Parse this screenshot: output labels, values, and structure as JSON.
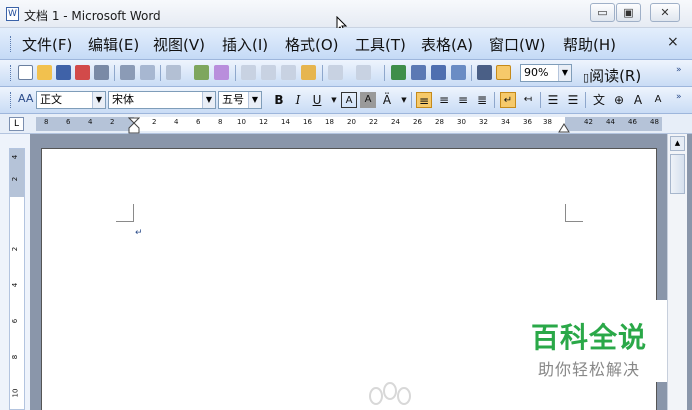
{
  "window": {
    "title": "文档 1 - Microsoft Word",
    "icon": "word-document-icon"
  },
  "window_controls": {
    "minimize": "▭",
    "maximize": "▣",
    "close": "✕"
  },
  "menu": {
    "items": [
      "文件(F)",
      "编辑(E)",
      "视图(V)",
      "插入(I)",
      "格式(O)",
      "工具(T)",
      "表格(A)",
      "窗口(W)",
      "帮助(H)"
    ],
    "close": "×"
  },
  "standard_toolbar": {
    "zoom": "90%",
    "read_label": "阅读(R)"
  },
  "formatting_toolbar": {
    "style": "正文",
    "font": "宋体",
    "size": "五号",
    "style_icon": "AA",
    "bold": "B",
    "italic": "I",
    "underline": "U",
    "char_border": "A",
    "char_shading": "A",
    "superscript_a": "A",
    "subscript_a": "A"
  },
  "ruler": {
    "left_ticks": [
      "8",
      "6",
      "4",
      "2"
    ],
    "right_ticks": [
      "2",
      "4",
      "6",
      "8",
      "10",
      "12",
      "14",
      "16",
      "18",
      "20",
      "22",
      "24",
      "26",
      "28",
      "30",
      "32",
      "34",
      "36",
      "38",
      "42",
      "44",
      "46",
      "48"
    ],
    "corner_label": "L"
  },
  "vertical_ruler": {
    "ticks": [
      "4",
      "2",
      "2",
      "4",
      "6",
      "8",
      "10"
    ]
  },
  "document": {
    "paragraph_mark": "↵"
  },
  "watermark": {
    "title": "百科全说",
    "subtitle": "助你轻松解决"
  },
  "colors": {
    "watermark_green": "#2aa848",
    "toolbar_blue": "#c9dcf5"
  }
}
